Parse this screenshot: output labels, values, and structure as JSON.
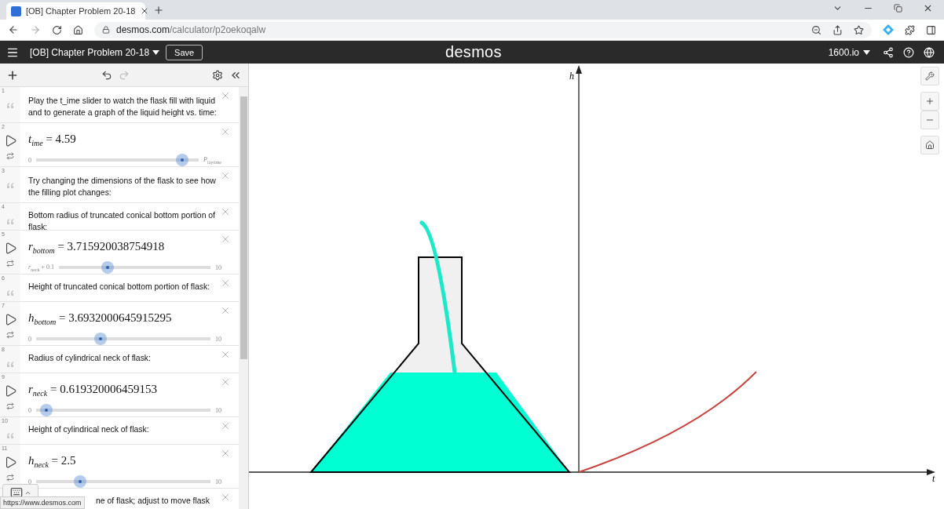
{
  "browser": {
    "tab_title": "[OB] Chapter Problem 20-18",
    "url_host": "desmos.com",
    "url_path": "/calculator/p2oekoqalw"
  },
  "header": {
    "title": "[OB] Chapter Problem 20-18",
    "save": "Save",
    "logo": "desmos",
    "account": "1600.io"
  },
  "expressions": [
    {
      "index": "1",
      "kind": "note",
      "text": "Play the t_ime slider to watch the flask fill with liquid and to generate a graph of the liquid height vs. time:"
    },
    {
      "index": "2",
      "kind": "slider",
      "formula": "*t*$_{ime}$ = 4.59",
      "min": "0",
      "max": "*P*$_{laytime}$",
      "level": 0.9
    },
    {
      "index": "3",
      "kind": "note",
      "text": "Try changing the dimensions of the flask to see how the filling plot changes:"
    },
    {
      "index": "4",
      "kind": "note",
      "text": "Bottom radius of truncated conical bottom portion of flask:"
    },
    {
      "index": "5",
      "kind": "slider",
      "formula": "*r*$_{bottom}$ = 3.715920038754918",
      "min": "*r*$_{neck}$ + 0.1",
      "max": "10",
      "level": 0.32
    },
    {
      "index": "6",
      "kind": "note",
      "text": "Height of truncated conical bottom portion of flask:"
    },
    {
      "index": "7",
      "kind": "slider",
      "formula": "*h*$_{bottom}$ = 3.6932000645915295",
      "min": "0",
      "max": "10",
      "level": 0.37
    },
    {
      "index": "8",
      "kind": "note",
      "text": "Radius of cylindrical neck of flask:"
    },
    {
      "index": "9",
      "kind": "slider",
      "formula": "*r*$_{neck}$ = 0.619320006459153",
      "min": "0",
      "max": "10",
      "level": 0.06
    },
    {
      "index": "10",
      "kind": "note",
      "text": "Height of cylindrical neck of flask:"
    },
    {
      "index": "11",
      "kind": "slider",
      "formula": "*h*$_{neck}$ = 2.5",
      "min": "0",
      "max": "10",
      "level": 0.25
    },
    {
      "kind": "note",
      "text": "ne of flask; adjust to move flask"
    }
  ],
  "graph": {
    "y_axis_label": "h",
    "x_axis_label": "t"
  },
  "status_url": "https://www.desmos.com"
}
